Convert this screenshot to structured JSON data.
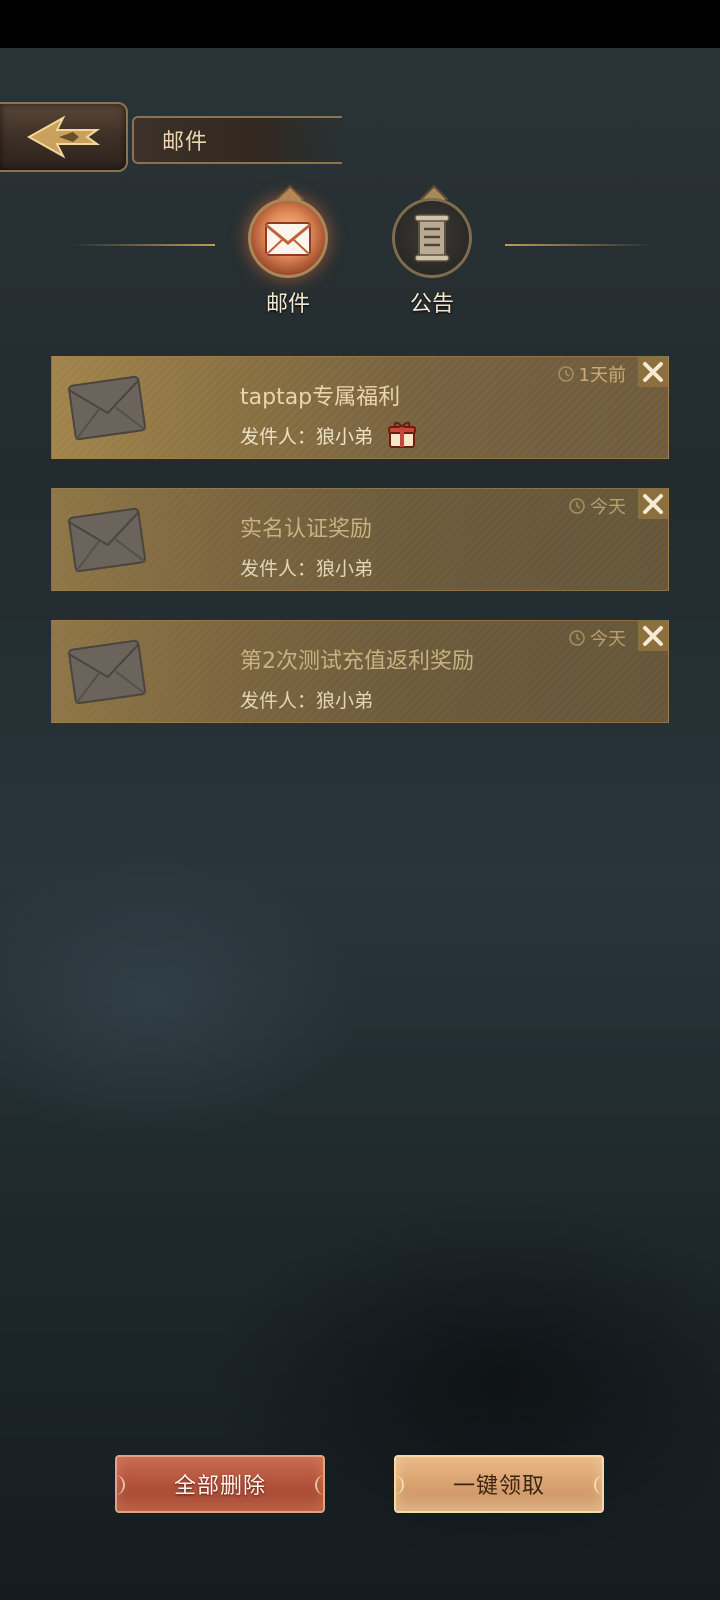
{
  "header": {
    "title": "邮件"
  },
  "tabs": [
    {
      "label": "邮件",
      "icon": "envelope-icon",
      "active": true
    },
    {
      "label": "公告",
      "icon": "scroll-icon",
      "active": false
    }
  ],
  "mails": [
    {
      "title": "taptap专属福利",
      "sender": "发件人：狼小弟",
      "time": "1天前",
      "has_gift": true,
      "read": false
    },
    {
      "title": "实名认证奖励",
      "sender": "发件人：狼小弟",
      "time": "今天",
      "has_gift": false,
      "read": true
    },
    {
      "title": "第2次测试充值返利奖励",
      "sender": "发件人：狼小弟",
      "time": "今天",
      "has_gift": false,
      "read": true
    }
  ],
  "buttons": {
    "delete_all": "全部删除",
    "claim_all": "一键领取"
  },
  "colors": {
    "accent_gold": "#bf9a58",
    "delete_red": "#b0503a",
    "claim_gold": "#d7a06d"
  }
}
